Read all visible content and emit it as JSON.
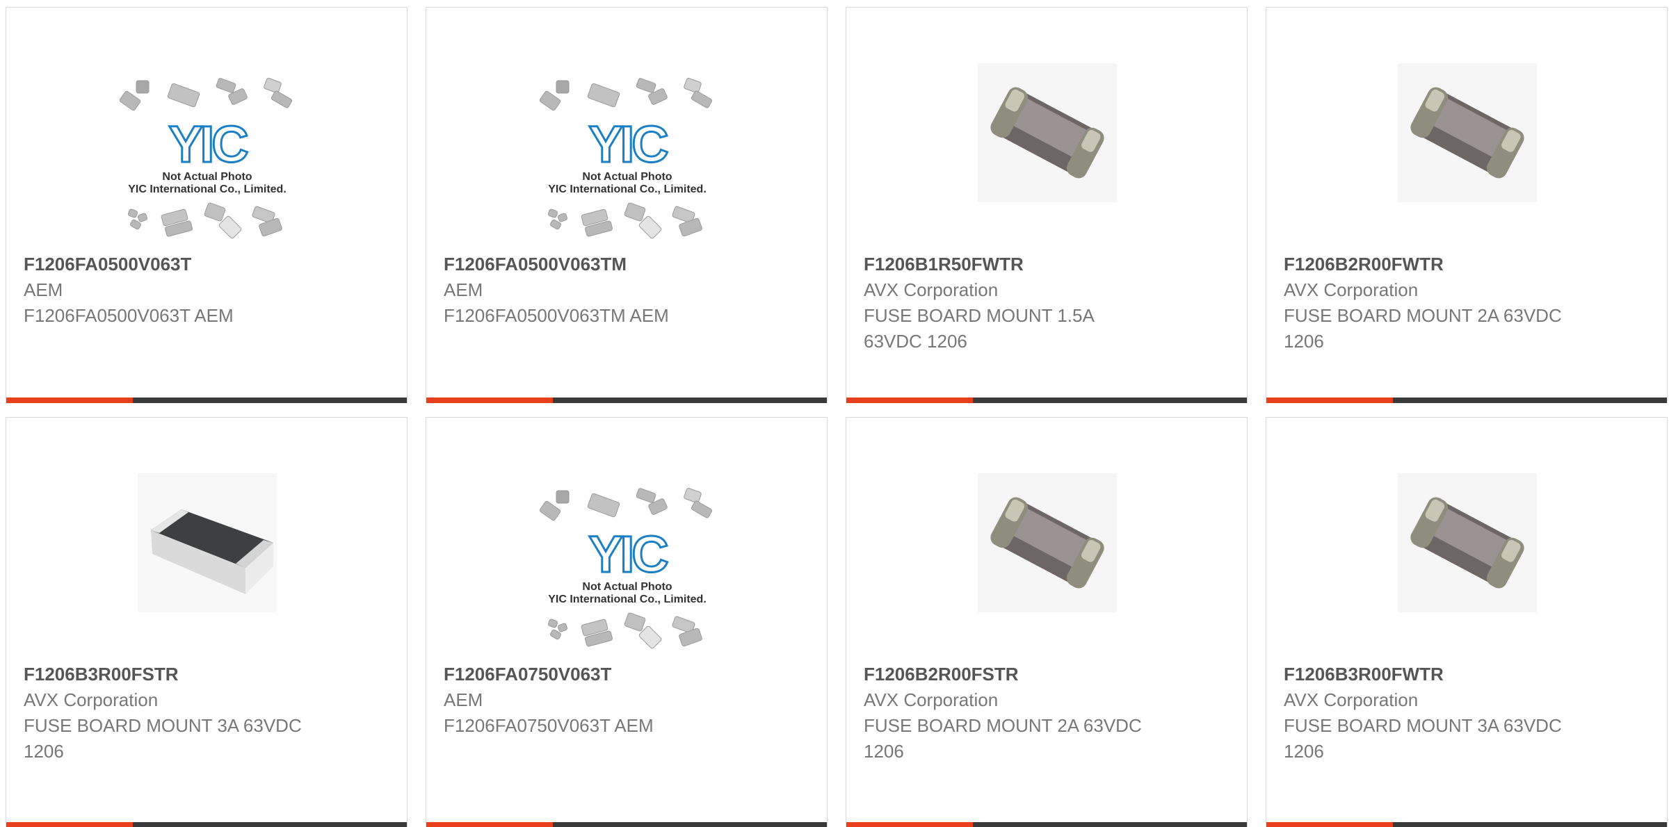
{
  "colors": {
    "accent": "#e8401c",
    "bar": "#3a3a3a",
    "border": "#d9d9d9",
    "part_number": "#555555",
    "text": "#777777",
    "yic_logo": "#1a7fc4"
  },
  "placeholder_photo": {
    "logo_text": "YIC",
    "line1": "Not Actual Photo",
    "line2": "YIC International Co., Limited."
  },
  "products": [
    {
      "part_number": "F1206FA0500V063T",
      "manufacturer": "AEM",
      "description": "F1206FA0500V063T AEM",
      "image": "placeholder-chips-icon"
    },
    {
      "part_number": "F1206FA0500V063TM",
      "manufacturer": "AEM",
      "description": "F1206FA0500V063TM AEM",
      "image": "placeholder-chips-icon"
    },
    {
      "part_number": "F1206B1R50FWTR",
      "manufacturer": "AVX Corporation",
      "description": "FUSE BOARD MOUNT 1.5A 63VDC 1206",
      "image": "smd-ceramic-chip-icon"
    },
    {
      "part_number": "F1206B2R00FWTR",
      "manufacturer": "AVX Corporation",
      "description": "FUSE BOARD MOUNT 2A 63VDC 1206",
      "image": "smd-ceramic-chip-icon"
    },
    {
      "part_number": "F1206B3R00FSTR",
      "manufacturer": "AVX Corporation",
      "description": "FUSE BOARD MOUNT 3A 63VDC 1206",
      "image": "smd-white-chip-icon"
    },
    {
      "part_number": "F1206FA0750V063T",
      "manufacturer": "AEM",
      "description": "F1206FA0750V063T AEM",
      "image": "placeholder-chips-icon"
    },
    {
      "part_number": "F1206B2R00FSTR",
      "manufacturer": "AVX Corporation",
      "description": "FUSE BOARD MOUNT 2A 63VDC 1206",
      "image": "smd-ceramic-chip-icon"
    },
    {
      "part_number": "F1206B3R00FWTR",
      "manufacturer": "AVX Corporation",
      "description": "FUSE BOARD MOUNT 3A 63VDC 1206",
      "image": "smd-ceramic-chip-icon"
    }
  ]
}
